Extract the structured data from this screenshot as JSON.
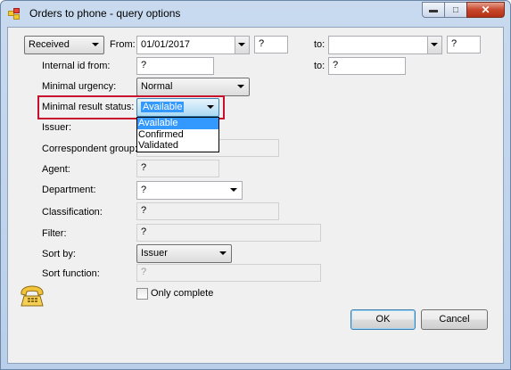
{
  "window": {
    "title": "Orders to phone - query options"
  },
  "colors": {
    "highlight": "#c8102e",
    "selection": "#3399ff"
  },
  "period": {
    "mode": "Received",
    "from_label": "From:",
    "from_date": "01/01/2017",
    "from_extra": "?",
    "to_label": "to:",
    "to_date": "",
    "to_extra": "?"
  },
  "internal_id": {
    "label": "Internal id from:",
    "from": "?",
    "to_label": "to:",
    "to": "?"
  },
  "urgency": {
    "label": "Minimal urgency:",
    "value": "Normal"
  },
  "result_status": {
    "label": "Minimal result status:",
    "value": "Available",
    "options": [
      "Available",
      "Confirmed",
      "Validated"
    ]
  },
  "issuer": {
    "label": "Issuer:"
  },
  "correspondent_group": {
    "label": "Correspondent group:"
  },
  "agent": {
    "label": "Agent:",
    "value": "?"
  },
  "department": {
    "label": "Department:",
    "value": "?"
  },
  "classification": {
    "label": "Classification:",
    "value": "?"
  },
  "filter": {
    "label": "Filter:",
    "value": "?"
  },
  "sort_by": {
    "label": "Sort by:",
    "value": "Issuer"
  },
  "sort_function": {
    "label": "Sort function:",
    "value": "?"
  },
  "only_complete": {
    "label": "Only complete",
    "checked": false
  },
  "buttons": {
    "ok": "OK",
    "cancel": "Cancel"
  },
  "icons": {
    "app": "orders-app-icon",
    "phone": "telephone-icon"
  }
}
